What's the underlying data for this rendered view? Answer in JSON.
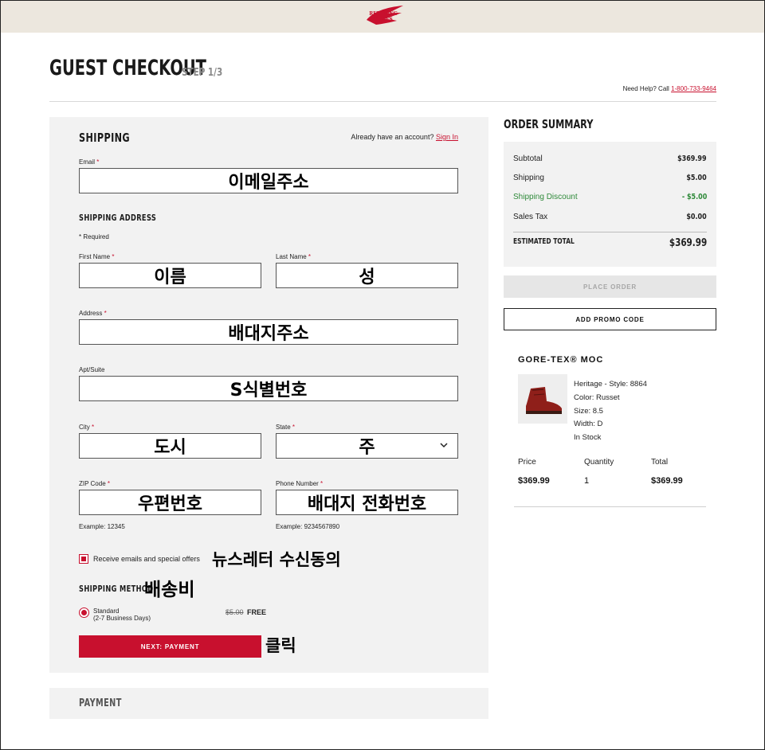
{
  "header": {
    "logo_line1": "RED WING",
    "logo_line2": "SHOES"
  },
  "page": {
    "title": "GUEST CHECKOUT",
    "step": "STEP 1/3",
    "help_text": "Need Help? Call ",
    "help_phone": "1-800-733-9464"
  },
  "shipping": {
    "heading": "SHIPPING",
    "account_prompt": "Already have an account?",
    "sign_in": "Sign In",
    "email_label": "Email",
    "email_value": "이메일주소",
    "address_heading": "SHIPPING ADDRESS",
    "required_note": "* Required",
    "first_name_label": "First Name",
    "first_name_value": "이름",
    "last_name_label": "Last Name",
    "last_name_value": "성",
    "address_label": "Address",
    "address_value": "배대지주소",
    "apt_label": "Apt/Suite",
    "apt_value": "S식별번호",
    "city_label": "City",
    "city_value": "도시",
    "state_label": "State",
    "state_value": "주",
    "zip_label": "ZIP Code",
    "zip_value": "우편번호",
    "zip_hint": "Example: 12345",
    "phone_label": "Phone Number",
    "phone_value": "배대지 전화번호",
    "phone_hint": "Example: 9234567890",
    "newsletter_label": "Receive emails and special offers",
    "newsletter_annot": "뉴스레터 수신동의",
    "method_heading": "SHIPPING METHOD",
    "method_annot": "배송비",
    "standard_line1": "Standard",
    "standard_line2": "(2-7 Business Days)",
    "old_price": "$5.00",
    "free": "FREE",
    "next_button": "NEXT: PAYMENT",
    "next_annot": "클릭"
  },
  "payment": {
    "heading": "PAYMENT"
  },
  "summary": {
    "heading": "ORDER SUMMARY",
    "subtotal_label": "Subtotal",
    "subtotal_value": "$369.99",
    "shipping_label": "Shipping",
    "shipping_value": "$5.00",
    "discount_label": "Shipping Discount",
    "discount_value": "- $5.00",
    "tax_label": "Sales Tax",
    "tax_value": "$0.00",
    "total_label": "ESTIMATED TOTAL",
    "total_value": "$369.99",
    "place_order": "PLACE ORDER",
    "promo": "ADD PROMO CODE"
  },
  "product": {
    "name": "GORE-TEX® MOC",
    "line": "Heritage - Style: 8864",
    "color": "Color: Russet",
    "size": "Size: 8.5",
    "width": "Width: D",
    "stock": "In Stock",
    "price_label": "Price",
    "price_value": "$369.99",
    "qty_label": "Quantity",
    "qty_value": "1",
    "total_label": "Total",
    "total_value": "$369.99"
  },
  "colors": {
    "brand_red": "#c8102e",
    "discount_green": "#2f8a3a",
    "panel_gray": "#f2f2f2",
    "header_beige": "#ece7de"
  }
}
